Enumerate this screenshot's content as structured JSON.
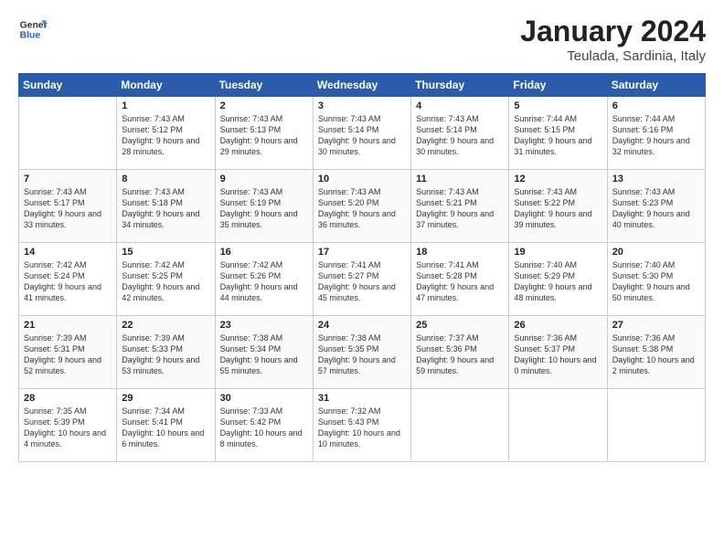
{
  "header": {
    "logo_general": "General",
    "logo_blue": "Blue",
    "month_title": "January 2024",
    "location": "Teulada, Sardinia, Italy"
  },
  "days_of_week": [
    "Sunday",
    "Monday",
    "Tuesday",
    "Wednesday",
    "Thursday",
    "Friday",
    "Saturday"
  ],
  "weeks": [
    [
      {
        "day": "",
        "sunrise": "",
        "sunset": "",
        "daylight": ""
      },
      {
        "day": "1",
        "sunrise": "7:43 AM",
        "sunset": "5:12 PM",
        "daylight": "9 hours and 28 minutes."
      },
      {
        "day": "2",
        "sunrise": "7:43 AM",
        "sunset": "5:13 PM",
        "daylight": "9 hours and 29 minutes."
      },
      {
        "day": "3",
        "sunrise": "7:43 AM",
        "sunset": "5:14 PM",
        "daylight": "9 hours and 30 minutes."
      },
      {
        "day": "4",
        "sunrise": "7:43 AM",
        "sunset": "5:14 PM",
        "daylight": "9 hours and 30 minutes."
      },
      {
        "day": "5",
        "sunrise": "7:44 AM",
        "sunset": "5:15 PM",
        "daylight": "9 hours and 31 minutes."
      },
      {
        "day": "6",
        "sunrise": "7:44 AM",
        "sunset": "5:16 PM",
        "daylight": "9 hours and 32 minutes."
      }
    ],
    [
      {
        "day": "7",
        "sunrise": "7:43 AM",
        "sunset": "5:17 PM",
        "daylight": "9 hours and 33 minutes."
      },
      {
        "day": "8",
        "sunrise": "7:43 AM",
        "sunset": "5:18 PM",
        "daylight": "9 hours and 34 minutes."
      },
      {
        "day": "9",
        "sunrise": "7:43 AM",
        "sunset": "5:19 PM",
        "daylight": "9 hours and 35 minutes."
      },
      {
        "day": "10",
        "sunrise": "7:43 AM",
        "sunset": "5:20 PM",
        "daylight": "9 hours and 36 minutes."
      },
      {
        "day": "11",
        "sunrise": "7:43 AM",
        "sunset": "5:21 PM",
        "daylight": "9 hours and 37 minutes."
      },
      {
        "day": "12",
        "sunrise": "7:43 AM",
        "sunset": "5:22 PM",
        "daylight": "9 hours and 39 minutes."
      },
      {
        "day": "13",
        "sunrise": "7:43 AM",
        "sunset": "5:23 PM",
        "daylight": "9 hours and 40 minutes."
      }
    ],
    [
      {
        "day": "14",
        "sunrise": "7:42 AM",
        "sunset": "5:24 PM",
        "daylight": "9 hours and 41 minutes."
      },
      {
        "day": "15",
        "sunrise": "7:42 AM",
        "sunset": "5:25 PM",
        "daylight": "9 hours and 42 minutes."
      },
      {
        "day": "16",
        "sunrise": "7:42 AM",
        "sunset": "5:26 PM",
        "daylight": "9 hours and 44 minutes."
      },
      {
        "day": "17",
        "sunrise": "7:41 AM",
        "sunset": "5:27 PM",
        "daylight": "9 hours and 45 minutes."
      },
      {
        "day": "18",
        "sunrise": "7:41 AM",
        "sunset": "5:28 PM",
        "daylight": "9 hours and 47 minutes."
      },
      {
        "day": "19",
        "sunrise": "7:40 AM",
        "sunset": "5:29 PM",
        "daylight": "9 hours and 48 minutes."
      },
      {
        "day": "20",
        "sunrise": "7:40 AM",
        "sunset": "5:30 PM",
        "daylight": "9 hours and 50 minutes."
      }
    ],
    [
      {
        "day": "21",
        "sunrise": "7:39 AM",
        "sunset": "5:31 PM",
        "daylight": "9 hours and 52 minutes."
      },
      {
        "day": "22",
        "sunrise": "7:39 AM",
        "sunset": "5:33 PM",
        "daylight": "9 hours and 53 minutes."
      },
      {
        "day": "23",
        "sunrise": "7:38 AM",
        "sunset": "5:34 PM",
        "daylight": "9 hours and 55 minutes."
      },
      {
        "day": "24",
        "sunrise": "7:38 AM",
        "sunset": "5:35 PM",
        "daylight": "9 hours and 57 minutes."
      },
      {
        "day": "25",
        "sunrise": "7:37 AM",
        "sunset": "5:36 PM",
        "daylight": "9 hours and 59 minutes."
      },
      {
        "day": "26",
        "sunrise": "7:36 AM",
        "sunset": "5:37 PM",
        "daylight": "10 hours and 0 minutes."
      },
      {
        "day": "27",
        "sunrise": "7:36 AM",
        "sunset": "5:38 PM",
        "daylight": "10 hours and 2 minutes."
      }
    ],
    [
      {
        "day": "28",
        "sunrise": "7:35 AM",
        "sunset": "5:39 PM",
        "daylight": "10 hours and 4 minutes."
      },
      {
        "day": "29",
        "sunrise": "7:34 AM",
        "sunset": "5:41 PM",
        "daylight": "10 hours and 6 minutes."
      },
      {
        "day": "30",
        "sunrise": "7:33 AM",
        "sunset": "5:42 PM",
        "daylight": "10 hours and 8 minutes."
      },
      {
        "day": "31",
        "sunrise": "7:32 AM",
        "sunset": "5:43 PM",
        "daylight": "10 hours and 10 minutes."
      },
      {
        "day": "",
        "sunrise": "",
        "sunset": "",
        "daylight": ""
      },
      {
        "day": "",
        "sunrise": "",
        "sunset": "",
        "daylight": ""
      },
      {
        "day": "",
        "sunrise": "",
        "sunset": "",
        "daylight": ""
      }
    ]
  ]
}
